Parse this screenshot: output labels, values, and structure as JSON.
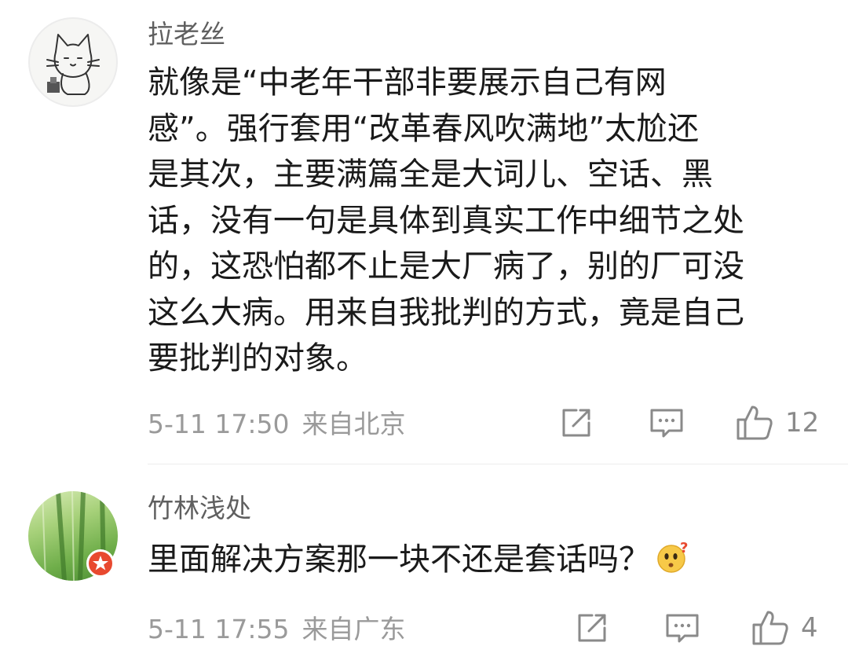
{
  "comments": [
    {
      "username": "拉老丝",
      "content_lines": [
        "就像是“中老年干部非要展示自己有网",
        "感”。强行套用“改革春风吹满地”太尬还",
        "是其次，主要满篇全是大词儿、空话、黑",
        "话，没有一句是具体到真实工作中细节之处",
        "的，这恐怕都不止是大厂病了，别的厂可没",
        "这么大病。用来自我批判的方式，竟是自己",
        "要批判的对象。"
      ],
      "timestamp": "5-11 17:50",
      "location": "来自北京",
      "likes": "12",
      "avatar_icon": "cat-sketch-avatar"
    },
    {
      "username": "竹林浅处",
      "content": "里面解决方案那一块不还是套话吗？",
      "emoji": "thinking-face-emoji",
      "timestamp": "5-11 17:55",
      "location": "来自广东",
      "likes": "4",
      "avatar_icon": "bamboo-photo-avatar",
      "badge_icon": "star-badge-icon"
    }
  ],
  "colors": {
    "text_primary": "#1a1a1a",
    "text_username": "#5f5f5f",
    "text_meta": "#9a9a9a",
    "icon": "#8a8a8a",
    "badge": "#e8492f",
    "divider": "#ededed"
  }
}
